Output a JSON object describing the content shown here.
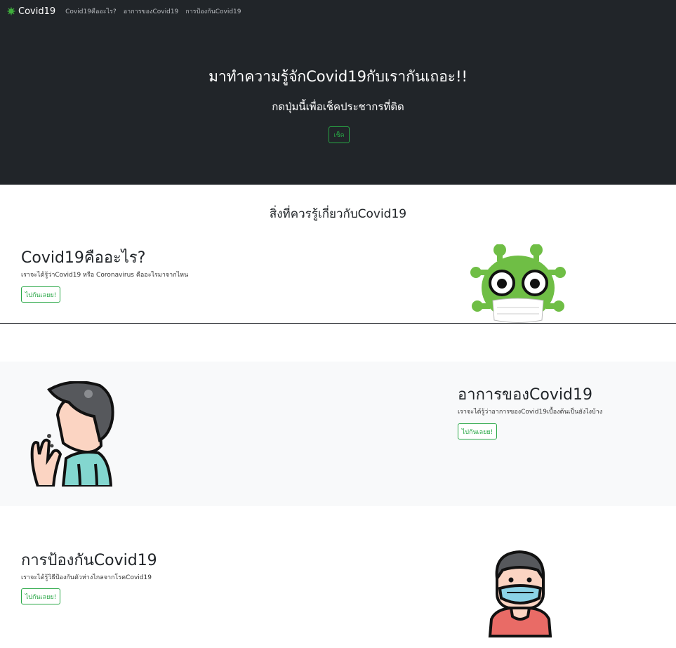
{
  "navbar": {
    "brand": "Covid19",
    "links": [
      "Covid19คืออะไร?",
      "อาการของCovid19",
      "การป้องกันCovid19"
    ]
  },
  "hero": {
    "title": "มาทำความรู้จักCovid19กับเรากันเถอะ!!",
    "subtitle": "กดปุ่มนี้เพื่อเช็คประชากรที่ติด",
    "button": "เช็ค"
  },
  "section": {
    "heading": "สิ่งที่ควรรู้เกี่ยวกับCovid19"
  },
  "features": [
    {
      "title": "Covid19คืออะไร?",
      "description": "เราจะได้รู้ว่าCovid19 หรือ Coronavirus คืออะไรมาจากไหน",
      "button": "ไปกันเลยย!",
      "icon": "virus-mascot-icon"
    },
    {
      "title": "อาการของCovid19",
      "description": "เราจะได้รู้ว่าอาการของCovid19เบื้องต้นเป็นยังไงบ้าง",
      "button": "ไปกันเลยย!",
      "icon": "coughing-person-icon"
    },
    {
      "title": "การป้องกันCovid19",
      "description": "เราจะได้รู้วิธีป้องกันตัวห่างไกลจากโรคCovid19",
      "button": "ไปกันเลยย!",
      "icon": "masked-person-icon"
    }
  ],
  "colors": {
    "hero_bg": "#212529",
    "accent": "#28a745",
    "virus_green": "#6fbe45",
    "band_bg": "#f8f9fa"
  }
}
